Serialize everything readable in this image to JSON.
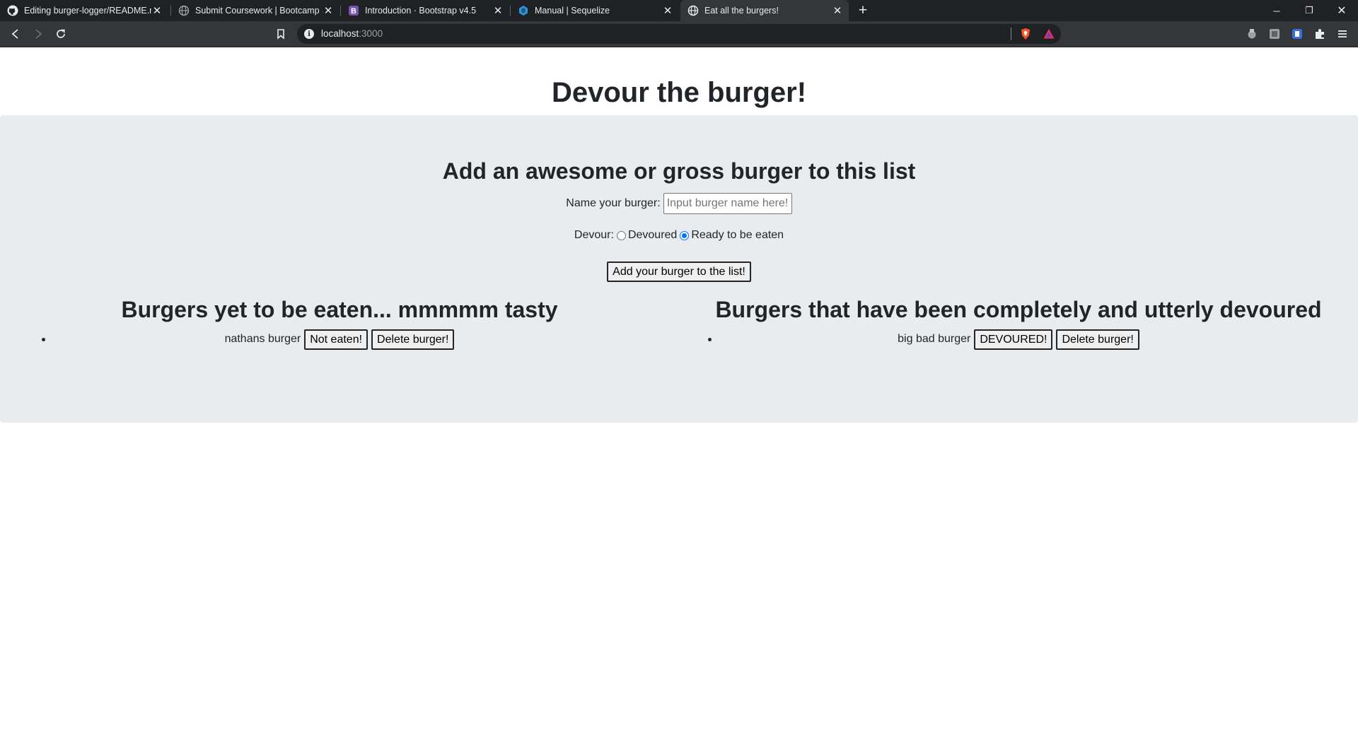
{
  "browser": {
    "tabs": [
      {
        "title": "Editing burger-logger/README.md",
        "icon": "github-icon"
      },
      {
        "title": "Submit Coursework | Bootcamp Spot",
        "icon": "globe-icon"
      },
      {
        "title": "Introduction · Bootstrap v4.5",
        "icon": "bootstrap-icon"
      },
      {
        "title": "Manual | Sequelize",
        "icon": "sequelize-icon"
      },
      {
        "title": "Eat all the burgers!",
        "icon": "globe-icon"
      }
    ],
    "active_tab": 4,
    "close_glyph": "✕",
    "new_tab_glyph": "+",
    "window_controls": {
      "minimize": "─",
      "restore": "❐",
      "close": "✕"
    },
    "url_host": "localhost",
    "url_port": ":3000"
  },
  "page": {
    "title": "Devour the burger!",
    "form": {
      "heading": "Add an awesome or gross burger to this list",
      "name_label": "Name your burger:",
      "name_placeholder": "Input burger name here!",
      "devour_label": "Devour:",
      "option_devoured": "Devoured",
      "option_ready": "Ready to be eaten",
      "selected_option": "Ready to be eaten",
      "submit_label": "Add your burger to the list!"
    },
    "not_eaten": {
      "heading": "Burgers yet to be eaten... mmmmm tasty",
      "items": [
        {
          "name": "nathans burger",
          "status_button": "Not eaten!",
          "delete_button": "Delete burger!"
        }
      ]
    },
    "devoured": {
      "heading": "Burgers that have been completely and utterly devoured",
      "items": [
        {
          "name": "big bad burger",
          "status_button": "DEVOURED!",
          "delete_button": "Delete burger!"
        }
      ]
    }
  },
  "colors": {
    "jumbotron_bg": "#e9ecef",
    "text": "#212529",
    "radio_accent": "#0075ff",
    "chrome_dark": "#202124",
    "chrome_toolbar": "#35363a"
  }
}
